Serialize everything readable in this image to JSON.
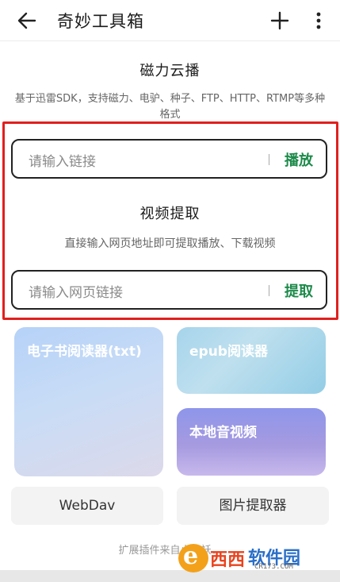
{
  "appbar": {
    "title": "奇妙工具箱"
  },
  "magnet": {
    "title": "磁力云播",
    "desc_line1": "基于迅雷SDK，支持磁力、电驴、种子、FTP、HTTP、RTMP等多种",
    "desc_line2": "格式",
    "placeholder": "请输入链接",
    "action": "播放"
  },
  "video": {
    "title": "视频提取",
    "desc": "直接输入网页地址即可提取播放、下载视频",
    "placeholder": "请输入网页链接",
    "action": "提取"
  },
  "cards": {
    "ebook": "电子书阅读器(txt)",
    "epub": "epub阅读器",
    "local": "本地音视频"
  },
  "buttons": {
    "webdav": "WebDav",
    "picture": "图片提取器"
  },
  "footer": "扩展插件来自小棉袄、",
  "watermark": {
    "letter": "e",
    "brand": "西西",
    "site": "软件园",
    "url": "CR173.COM"
  },
  "colors": {
    "accent_green": "#1c8a4a",
    "highlight_red": "#e0201e"
  },
  "icons": {
    "back": "arrow-left",
    "add": "plus",
    "more": "more-vertical"
  }
}
